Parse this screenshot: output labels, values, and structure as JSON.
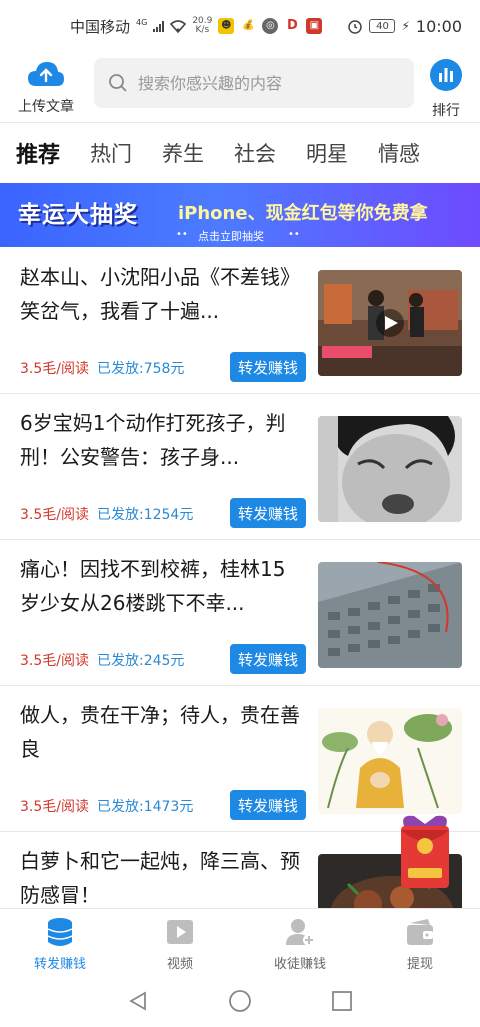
{
  "status_bar": {
    "carrier": "中国移动",
    "network": "4G",
    "speed_value": "20.9",
    "speed_unit": "K/s",
    "battery": "40",
    "time": "10:00"
  },
  "header": {
    "upload_label": "上传文章",
    "search_placeholder": "搜索你感兴趣的内容",
    "rank_label": "排行"
  },
  "tabs": [
    {
      "label": "推荐",
      "active": true
    },
    {
      "label": "热门",
      "active": false
    },
    {
      "label": "养生",
      "active": false
    },
    {
      "label": "社会",
      "active": false
    },
    {
      "label": "明星",
      "active": false
    },
    {
      "label": "情感",
      "active": false
    }
  ],
  "banner": {
    "title": "幸运大抽奖",
    "subtitle": "iPhone、现金红包等你免费拿",
    "cta": "点击立即抽奖"
  },
  "articles": [
    {
      "title": "赵本山、小沈阳小品《不差钱》笑岔气，我看了十遍...",
      "rate": "3.5毛/阅读",
      "paid": "已发放:758元",
      "share": "转发赚钱"
    },
    {
      "title": "6岁宝妈1个动作打死孩子，判刑！公安警告：孩子身...",
      "rate": "3.5毛/阅读",
      "paid": "已发放:1254元",
      "share": "转发赚钱"
    },
    {
      "title": "痛心！因找不到校裤，桂林15岁少女从26楼跳下不幸...",
      "rate": "3.5毛/阅读",
      "paid": "已发放:245元",
      "share": "转发赚钱"
    },
    {
      "title": "做人，贵在干净；待人，贵在善良",
      "rate": "3.5毛/阅读",
      "paid": "已发放:1473元",
      "share": "转发赚钱"
    },
    {
      "title": "白萝卜和它一起炖，降三高、预防感冒！",
      "rate": "",
      "paid": "",
      "share": ""
    }
  ],
  "bottom_nav": [
    {
      "label": "转发赚钱",
      "icon": "coins-icon",
      "active": true
    },
    {
      "label": "视频",
      "icon": "video-icon",
      "active": false
    },
    {
      "label": "收徒赚钱",
      "icon": "add-user-icon",
      "active": false
    },
    {
      "label": "提现",
      "icon": "wallet-icon",
      "active": false
    }
  ],
  "colors": {
    "accent": "#1e88e5",
    "rate": "#d0382b",
    "paid": "#2a8ad6"
  }
}
